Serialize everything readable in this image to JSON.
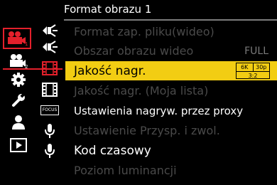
{
  "header": {
    "title": "Format obrazu 1"
  },
  "left_tabs": [
    {
      "icon": "video-camera-icon",
      "badge": "1",
      "active": true
    },
    {
      "icon": "video-camera-icon",
      "badge": "2",
      "active": false
    },
    {
      "icon": "gear-icon",
      "active": false
    },
    {
      "icon": "wrench-icon",
      "active": false
    },
    {
      "icon": "person-icon",
      "active": false
    },
    {
      "icon": "playback-icon",
      "active": false
    }
  ],
  "mid_icons": [
    "movie-frame-arrows-icon",
    "movie-frame-arrows-icon",
    "film-strip-icon",
    "film-strip-icon",
    "focus-icon",
    "microphone-icon",
    "microphone-icon",
    "empty",
    "empty"
  ],
  "focus_icon_text": "FOCUS",
  "menu": {
    "items": [
      {
        "label": "Format zap. pliku(wideo)",
        "state": "dim"
      },
      {
        "label": "Obszar obrazu wideo",
        "value": "FULL",
        "state": "dim"
      },
      {
        "label": "Jakość nagr.",
        "state": "selected",
        "badge": {
          "res": "6K",
          "fps": "30p",
          "ratio": "3:2"
        }
      },
      {
        "label": "Jakość nagr. (Moja lista)",
        "state": "dim"
      },
      {
        "label": "Ustawienia nagryw. przez proxy",
        "state": "normal"
      },
      {
        "label": "Ustawienie Przysp. i zwol.",
        "state": "dim"
      },
      {
        "label": "Kod czasowy",
        "state": "normal"
      },
      {
        "label": "Poziom luminancji",
        "state": "dim"
      }
    ]
  },
  "colors": {
    "accent_red": "#e3202b",
    "highlight_yellow": "#f2cd13",
    "dim_text": "#4a4a4a"
  }
}
